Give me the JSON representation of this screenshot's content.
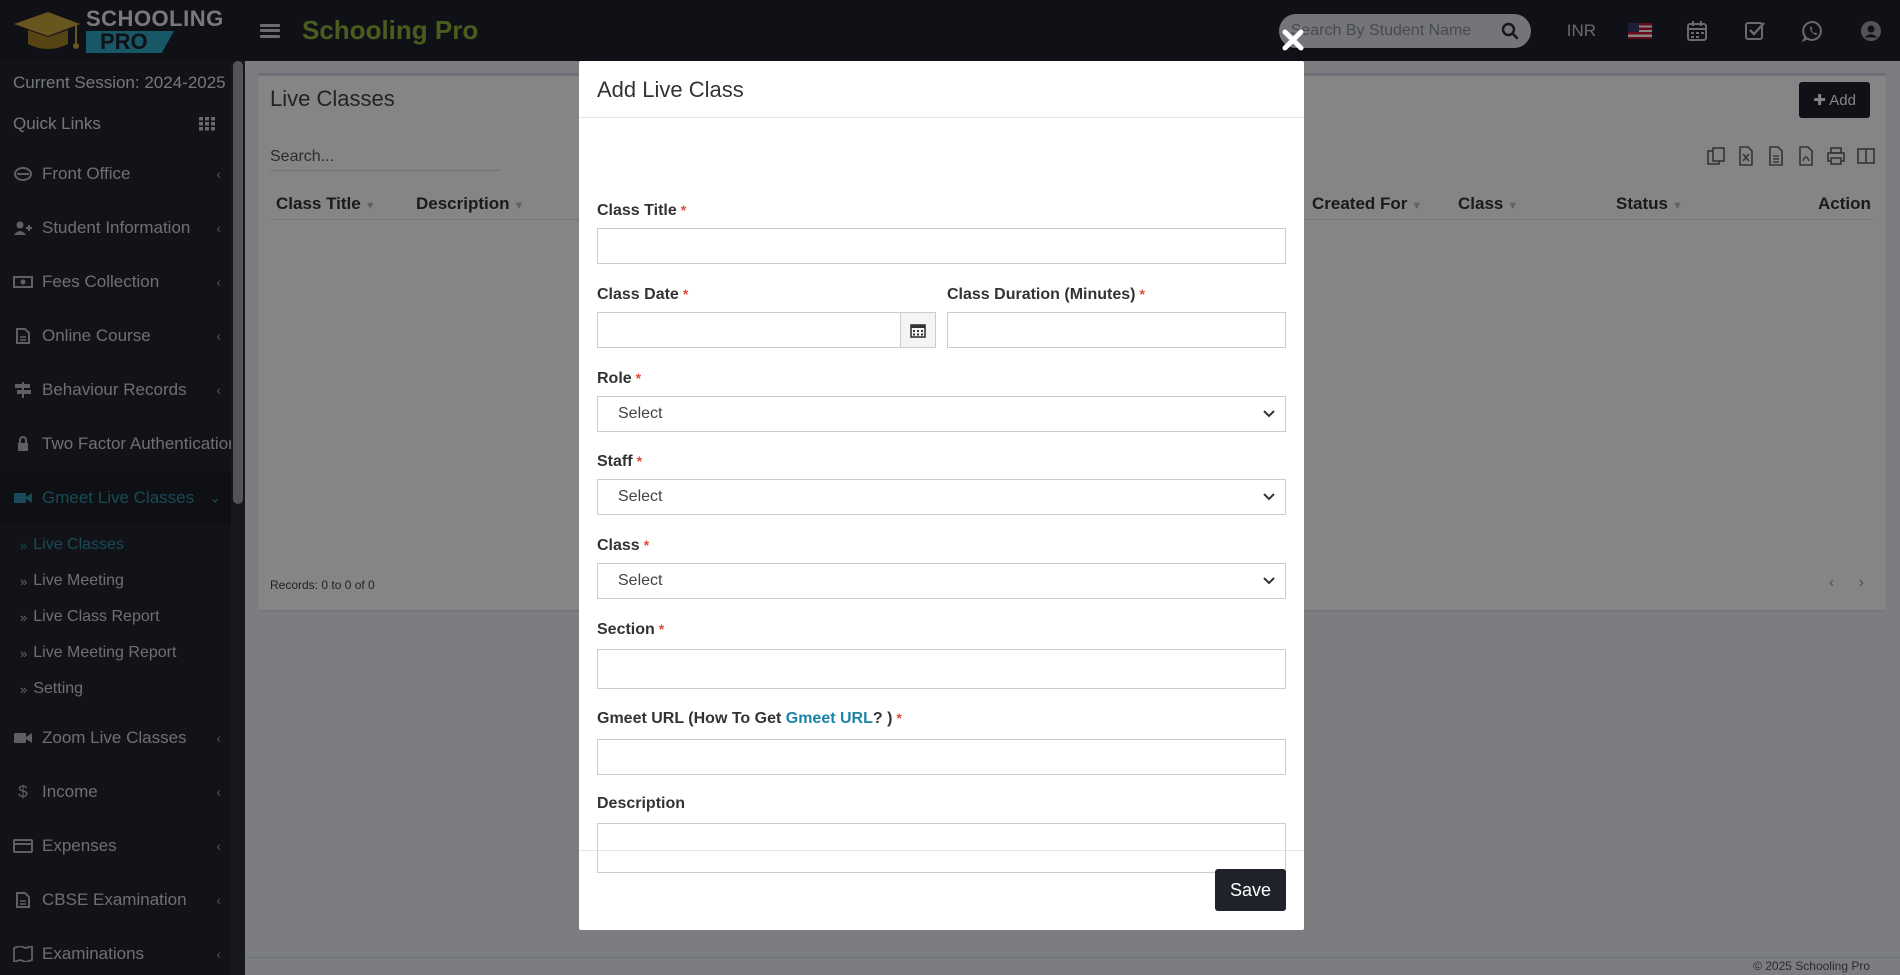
{
  "header": {
    "logo_line1": "SCHOOLING",
    "logo_line2": "PRO",
    "brand": "Schooling Pro",
    "search_placeholder": "Search By Student Name",
    "currency": "INR"
  },
  "sidebar": {
    "session": "Current Session: 2024-2025",
    "quick_links": "Quick Links",
    "items": [
      {
        "label": "Front Office"
      },
      {
        "label": "Student Information"
      },
      {
        "label": "Fees Collection"
      },
      {
        "label": "Online Course"
      },
      {
        "label": "Behaviour Records"
      },
      {
        "label": "Two Factor Authentication"
      },
      {
        "label": "Gmeet Live Classes"
      },
      {
        "label": "Zoom Live Classes"
      },
      {
        "label": "Income"
      },
      {
        "label": "Expenses"
      },
      {
        "label": "CBSE Examination"
      },
      {
        "label": "Examinations"
      }
    ],
    "sub_items": [
      {
        "label": "Live Classes"
      },
      {
        "label": "Live Meeting"
      },
      {
        "label": "Live Class Report"
      },
      {
        "label": "Live Meeting Report"
      },
      {
        "label": "Setting"
      }
    ]
  },
  "panel": {
    "title": "Live Classes",
    "add_label": "Add",
    "search_placeholder": "Search...",
    "columns": [
      "Class Title",
      "Description",
      "Created For",
      "Class",
      "Status",
      "Action"
    ],
    "records": "Records: 0 to 0 of 0",
    "pager": "‹ ›"
  },
  "footer": {
    "copyright": "© 2025 Schooling Pro"
  },
  "modal": {
    "title": "Add Live Class",
    "class_title_label": "Class Title",
    "class_date_label": "Class Date",
    "duration_label": "Class Duration (Minutes)",
    "role_label": "Role",
    "role_value": "Select",
    "staff_label": "Staff",
    "staff_value": "Select",
    "class_label": "Class",
    "class_value": "Select",
    "section_label": "Section",
    "gmeet_label_pre": "Gmeet URL (How To Get ",
    "gmeet_link": "Gmeet URL",
    "gmeet_label_post": "? )",
    "description_label": "Description",
    "required_mark": "*",
    "save_label": "Save"
  },
  "colors": {
    "header_bg": "#1f222b",
    "brand_green": "#8cb33a",
    "accent_teal": "#2e8fa8",
    "required_red": "#dd4b39"
  }
}
